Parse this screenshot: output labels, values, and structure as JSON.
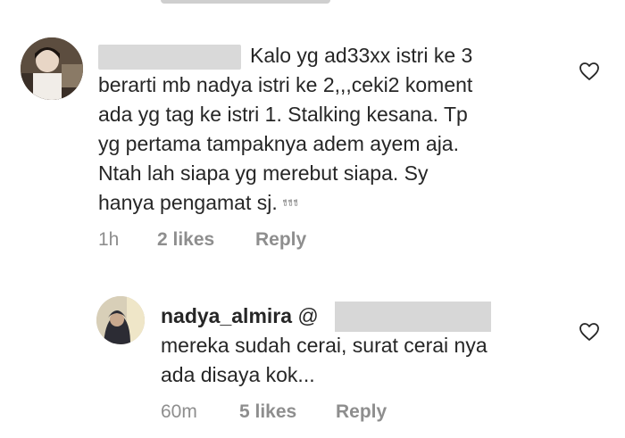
{
  "comments": [
    {
      "text_after_redaction": "Kalo yg ad33xx istri ke 3\nberarti mb nadya istri ke 2,,,ceki2 koment\nada yg tag ke istri 1. Stalking kesana. Tp\nyg pertama tampaknya adem ayem aja.\nNtah lah siapa yg merebut siapa. Sy\nhanya pengamat sj. ",
      "emoji": "✌✌✌",
      "time": "1h",
      "likes": "2 likes",
      "reply": "Reply"
    },
    {
      "username": "nadya_almira",
      "mention_prefix": "@",
      "text": "mereka sudah cerai, surat cerai nya\nada disaya kok...",
      "time": "60m",
      "likes": "5 likes",
      "reply": "Reply"
    }
  ],
  "icons": {
    "like": "heart-outline-icon",
    "emoji": "victory-hand-emoji"
  },
  "colors": {
    "text": "#262626",
    "meta": "#8e8e8e",
    "redaction": "#d9d9d9"
  }
}
